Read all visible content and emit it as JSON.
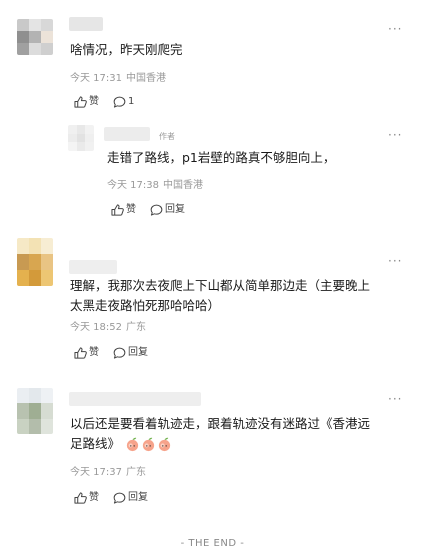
{
  "icons": {
    "like": "thumbs-up-icon",
    "comment": "speech-bubble-icon",
    "more": "more-dots-icon",
    "emoji": "peach-emoji-icon"
  },
  "colors": {
    "text": "#1a1a1a",
    "meta": "#999999",
    "action": "#444444"
  },
  "comments": [
    {
      "text": "啥情况，昨天刚爬完",
      "time": "今天 17:31",
      "location": "中国香港",
      "like_label": "赞",
      "comment_label": "1"
    },
    {
      "author_badge": "作者",
      "text": "走错了路线，p1岩壁的路真不够胆向上，",
      "time": "今天 17:38",
      "location": "中国香港",
      "like_label": "赞",
      "comment_label": "回复"
    },
    {
      "text_line1": "理解，我那次去夜爬上下山都从简单那边走（主要晚上",
      "text_line2": "太黑走夜路怕死那哈哈哈）",
      "time": "今天 18:52",
      "location": "广东",
      "like_label": "赞",
      "comment_label": "回复"
    },
    {
      "text_line1": "以后还是要看着轨迹走，跟着轨迹没有迷路过《香港远",
      "text_line2": "足路线》",
      "time": "今天 17:37",
      "location": "广东",
      "like_label": "赞",
      "comment_label": "回复"
    }
  ],
  "footer": {
    "end_text": "- THE END -"
  }
}
